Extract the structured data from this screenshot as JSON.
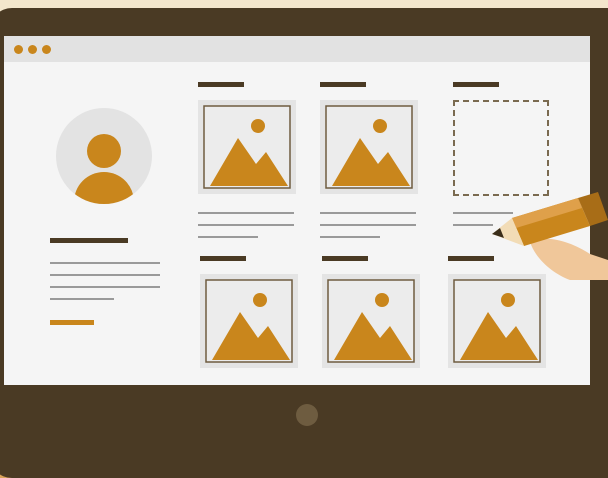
{
  "illustration": {
    "colors": {
      "background": "#d9a35a",
      "device_frame": "#4a3a24",
      "screen": "#f5f5f5",
      "accent": "#c9861c",
      "placeholder_card": "#e4e4e4"
    },
    "icons": [
      "user-avatar-icon",
      "image-placeholder-icon",
      "pencil-icon"
    ],
    "image_cards": 5,
    "empty_slots": 1
  }
}
